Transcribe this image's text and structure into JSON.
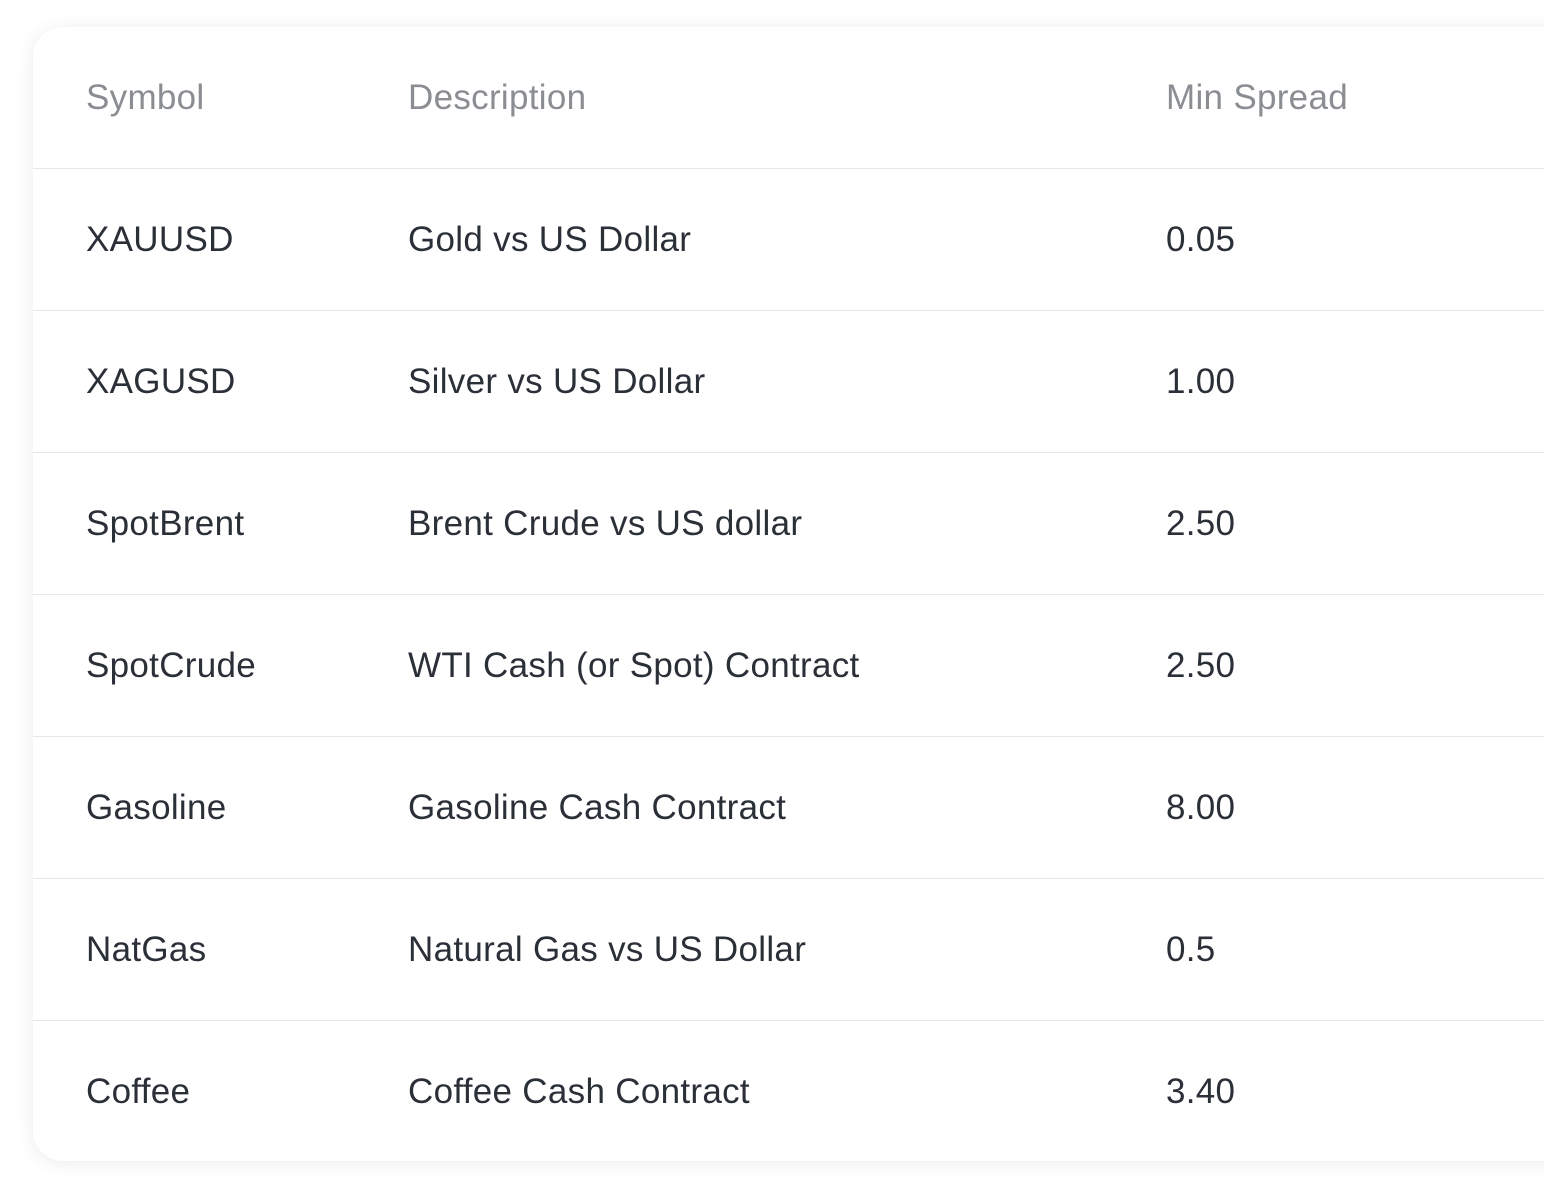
{
  "table": {
    "headers": [
      "Symbol",
      "Description",
      "Min Spread"
    ],
    "rows": [
      [
        "XAUUSD",
        "Gold vs US Dollar",
        "0.05"
      ],
      [
        "XAGUSD",
        "Silver vs US Dollar",
        "1.00"
      ],
      [
        "SpotBrent",
        "Brent Crude vs US dollar",
        "2.50"
      ],
      [
        "SpotCrude",
        "WTI Cash (or Spot) Contract",
        "2.50"
      ],
      [
        "Gasoline",
        "Gasoline Cash Contract",
        "8.00"
      ],
      [
        "NatGas",
        "Natural Gas vs US Dollar",
        "0.5"
      ],
      [
        "Coffee",
        "Coffee Cash Contract",
        "3.40"
      ]
    ]
  }
}
